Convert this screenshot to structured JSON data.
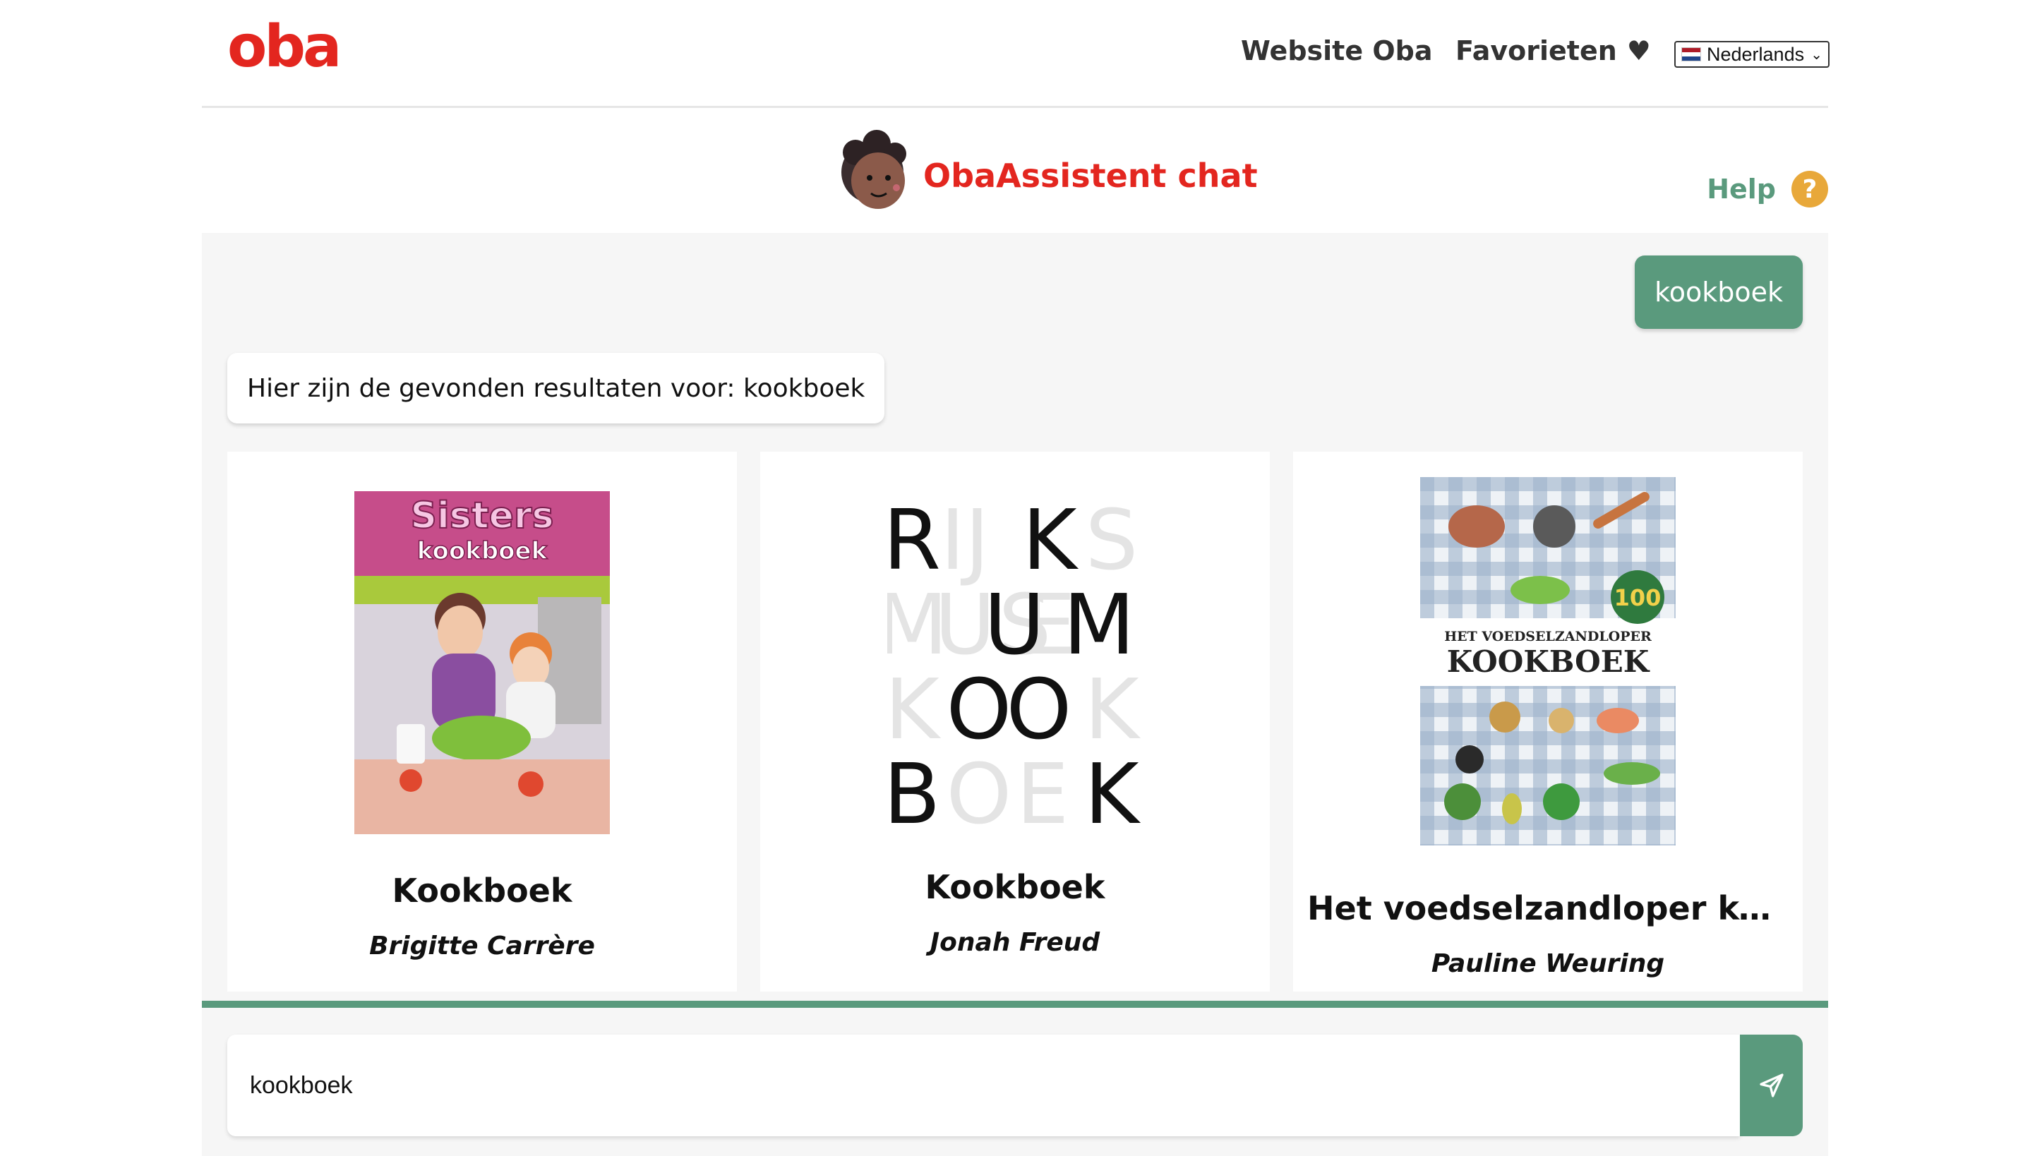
{
  "brand": {
    "logo_text": "oba",
    "accent_red": "#e3261f",
    "accent_green": "#5a9a7d",
    "help_color": "#e8a83a"
  },
  "nav": {
    "website_label": "Website Oba",
    "favorites_label": "Favorieten",
    "language": {
      "selected": "Nederlands"
    }
  },
  "header": {
    "chat_title": "ObaAssistent chat",
    "help_label": "Help",
    "help_icon_glyph": "?"
  },
  "chat": {
    "user_message": "kookboek",
    "bot_message": "Hier zijn de gevonden resultaten voor: kookboek",
    "results": [
      {
        "title": "Kookboek",
        "author": "Brigitte Carrère",
        "cover": "sisters-kookboek-cover"
      },
      {
        "title": "Kookboek",
        "author": "Jonah Freud",
        "cover": "rijksmuseum-kookboek-cover"
      },
      {
        "title": "Het voedselzandloper koo...",
        "author": "Pauline Weuring",
        "cover": "voedselzandloper-kookboek-cover"
      }
    ]
  },
  "input": {
    "value": "kookboek"
  },
  "cover_text": {
    "card1": {
      "title_line1": "Sisters",
      "title_line2": "kookboek"
    },
    "card2": {
      "letters": [
        "R",
        "IJ",
        "K",
        "S",
        "M",
        "U",
        "S",
        "E",
        "U",
        "M",
        "K",
        "O",
        "O",
        "K",
        "B",
        "O",
        "E",
        "K"
      ]
    },
    "card3": {
      "badge": "100",
      "line1": "HET VOEDSELZANDLOPER",
      "line2": "KOOKBOEK"
    }
  }
}
